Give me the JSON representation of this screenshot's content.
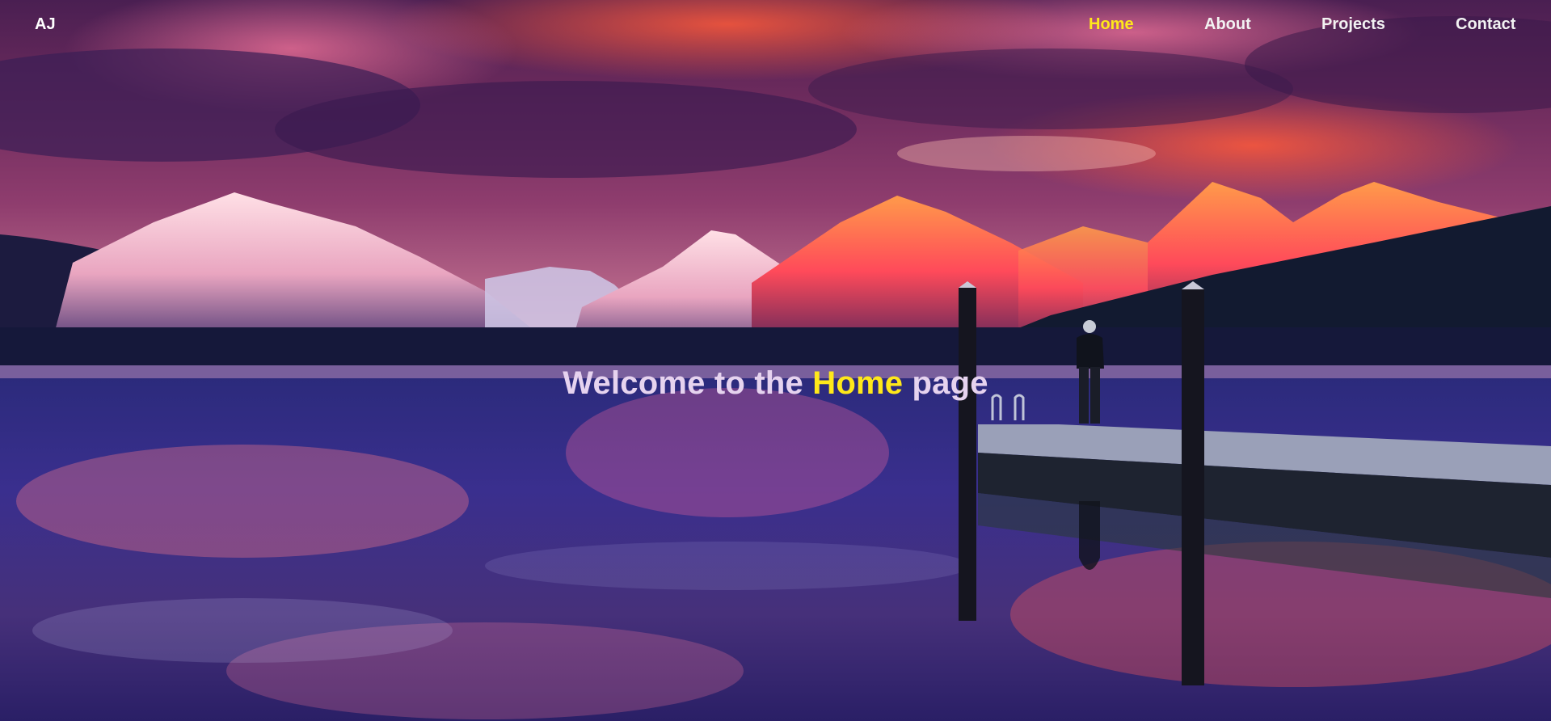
{
  "brand": {
    "logo_text": "AJ"
  },
  "nav": {
    "items": [
      {
        "label": "Home",
        "active": true
      },
      {
        "label": "About",
        "active": false
      },
      {
        "label": "Projects",
        "active": false
      },
      {
        "label": "Contact",
        "active": false
      }
    ]
  },
  "hero": {
    "title_before": "Welcome to the",
    "title_highlight": "Home",
    "title_after": "page",
    "image_subject": "sunset mountain lake with dock and person"
  },
  "colors": {
    "accent": "#ffe81a",
    "nav_text": "#f2f2f2",
    "headline_text": "#e6d3ef"
  }
}
